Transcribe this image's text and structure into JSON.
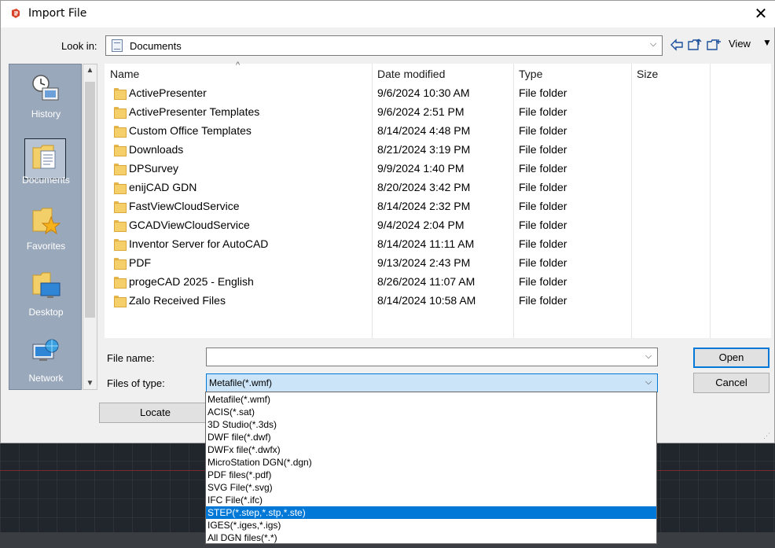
{
  "window": {
    "title": "Import File",
    "close_glyph": "✕"
  },
  "toolbar": {
    "look_in_label": "Look in:",
    "look_in_value": "Documents",
    "view_label": "View"
  },
  "places": [
    {
      "label": "History",
      "icon": "history-icon"
    },
    {
      "label": "Documents",
      "icon": "documents-icon"
    },
    {
      "label": "Favorites",
      "icon": "favorites-icon"
    },
    {
      "label": "Desktop",
      "icon": "desktop-icon"
    },
    {
      "label": "Network",
      "icon": "network-icon"
    }
  ],
  "columns": {
    "name": "Name",
    "date": "Date modified",
    "type": "Type",
    "size": "Size"
  },
  "files": [
    {
      "name": "ActivePresenter",
      "date": "9/6/2024 10:30 AM",
      "type": "File folder"
    },
    {
      "name": "ActivePresenter Templates",
      "date": "9/6/2024 2:51 PM",
      "type": "File folder"
    },
    {
      "name": "Custom Office Templates",
      "date": "8/14/2024 4:48 PM",
      "type": "File folder"
    },
    {
      "name": "Downloads",
      "date": "8/21/2024 3:19 PM",
      "type": "File folder"
    },
    {
      "name": "DPSurvey",
      "date": "9/9/2024 1:40 PM",
      "type": "File folder"
    },
    {
      "name": "enijCAD GDN",
      "date": "8/20/2024 3:42 PM",
      "type": "File folder"
    },
    {
      "name": "FastViewCloudService",
      "date": "8/14/2024 2:32 PM",
      "type": "File folder"
    },
    {
      "name": "GCADViewCloudService",
      "date": "9/4/2024 2:04 PM",
      "type": "File folder"
    },
    {
      "name": "Inventor Server for AutoCAD",
      "date": "8/14/2024 11:11 AM",
      "type": "File folder"
    },
    {
      "name": "PDF",
      "date": "9/13/2024 2:43 PM",
      "type": "File folder"
    },
    {
      "name": "progeCAD 2025 - English",
      "date": "8/26/2024 11:07 AM",
      "type": "File folder"
    },
    {
      "name": "Zalo Received Files",
      "date": "8/14/2024 10:58 AM",
      "type": "File folder"
    }
  ],
  "form": {
    "file_name_label": "File name:",
    "file_name_value": "",
    "files_of_type_label": "Files of type:",
    "files_of_type_value": "Metafile(*.wmf)",
    "open_label": "Open",
    "cancel_label": "Cancel",
    "locate_label": "Locate"
  },
  "file_types": [
    "Metafile(*.wmf)",
    "ACIS(*.sat)",
    "3D Studio(*.3ds)",
    "DWF file(*.dwf)",
    "DWFx file(*.dwfx)",
    "MicroStation DGN(*.dgn)",
    "PDF files(*.pdf)",
    "SVG File(*.svg)",
    "IFC File(*.ifc)",
    "STEP(*.step,*.stp,*.ste)",
    "IGES(*.iges,*.igs)",
    "All DGN files(*.*)"
  ],
  "highlighted_file_type": "STEP(*.step,*.stp,*.ste)",
  "colors": {
    "accent": "#0078d7",
    "places_bg": "#9aa8bb",
    "folder": "#f5cf6a"
  }
}
